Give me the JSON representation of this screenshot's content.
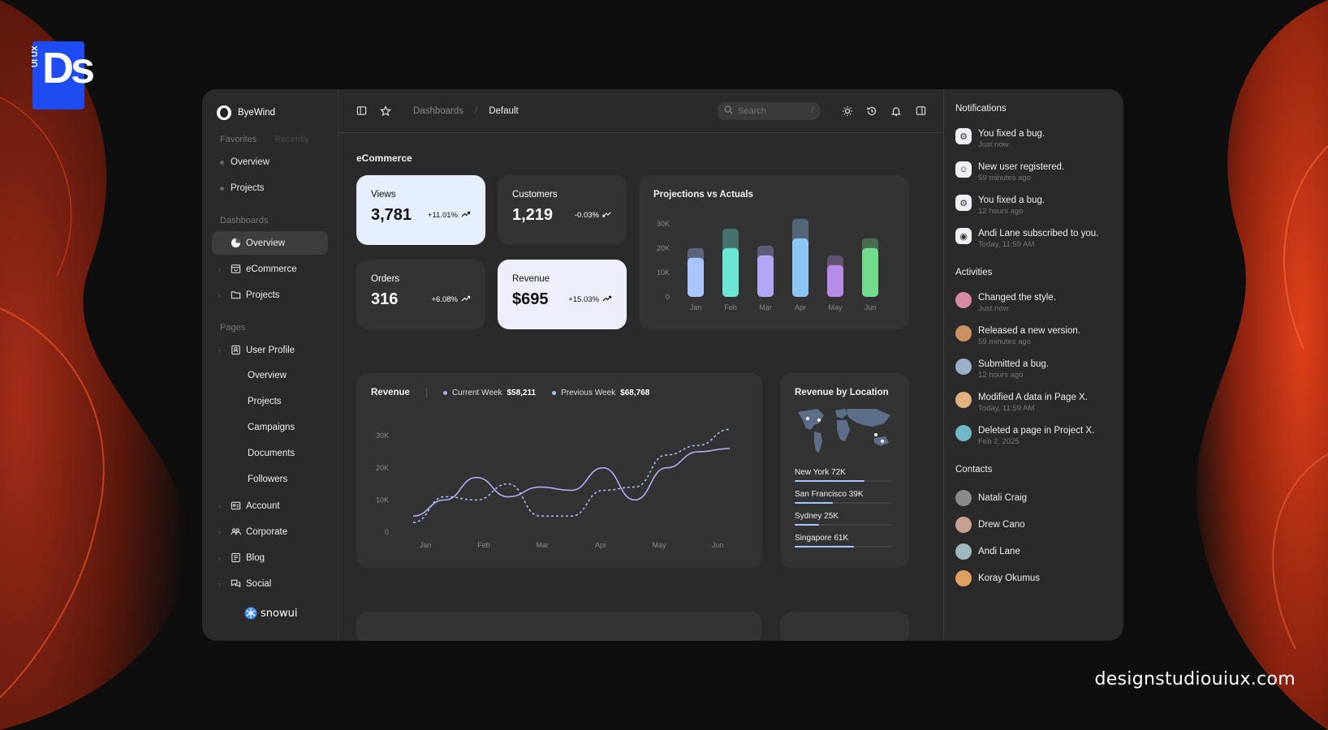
{
  "brand": {
    "name": "ByeWind",
    "logo_text": "Ds",
    "logo_side": "UI UX"
  },
  "watermark": "designstudiouiux.com",
  "sidebar": {
    "tabs": [
      "Favorites",
      "Recently"
    ],
    "favorites": [
      "Overview",
      "Projects"
    ],
    "dashboards_title": "Dashboards",
    "dashboards": [
      {
        "label": "Overview",
        "icon": "pie-chart-icon",
        "active": true
      },
      {
        "label": "eCommerce",
        "icon": "shopping-bag-icon"
      },
      {
        "label": "Projects",
        "icon": "folder-icon"
      }
    ],
    "pages_title": "Pages",
    "user_profile": {
      "label": "User Profile",
      "icon": "id-badge-icon"
    },
    "user_profile_sub": [
      "Overview",
      "Projects",
      "Campaigns",
      "Documents",
      "Followers"
    ],
    "pages": [
      {
        "label": "Account",
        "icon": "id-card-icon"
      },
      {
        "label": "Corporate",
        "icon": "users-icon"
      },
      {
        "label": "Blog",
        "icon": "notebook-icon"
      },
      {
        "label": "Social",
        "icon": "chat-bubbles-icon"
      }
    ],
    "footer_logo": "snowui"
  },
  "topbar": {
    "breadcrumb": [
      "Dashboards",
      "Default"
    ],
    "separator": "/",
    "search_placeholder": "Search",
    "search_shortcut": "/"
  },
  "main": {
    "heading": "eCommerce",
    "stats": [
      {
        "label": "Views",
        "value": "3,781",
        "change": "+11.01%",
        "trend": "up"
      },
      {
        "label": "Customers",
        "value": "1,219",
        "change": "-0.03%",
        "trend": "down"
      },
      {
        "label": "Orders",
        "value": "316",
        "change": "+6.08%",
        "trend": "up"
      },
      {
        "label": "Revenue",
        "value": "$695",
        "change": "+15.03%",
        "trend": "up"
      }
    ],
    "projections_title": "Projections vs Actuals",
    "revenue_title": "Revenue",
    "revenue_legend": [
      {
        "label": "Current Week",
        "value": "$58,211",
        "color": "#a8a8ff"
      },
      {
        "label": "Previous Week",
        "value": "$68,768",
        "color": "#a8c5ff"
      }
    ],
    "location_title": "Revenue by Location",
    "locations": [
      {
        "label": "New York",
        "value": "72K",
        "fraction": 0.72
      },
      {
        "label": "San Francisco",
        "value": "39K",
        "fraction": 0.39
      },
      {
        "label": "Sydney",
        "value": "25K",
        "fraction": 0.25
      },
      {
        "label": "Singapore",
        "value": "61K",
        "fraction": 0.61
      }
    ]
  },
  "chart_data": [
    {
      "type": "bar",
      "title": "Projections vs Actuals",
      "categories": [
        "Jan",
        "Feb",
        "Mar",
        "Apr",
        "May",
        "Jun"
      ],
      "yticks": [
        "0",
        "10K",
        "20K",
        "30K"
      ],
      "ylim": [
        0,
        30000
      ],
      "series": [
        {
          "values": [
            16000,
            20000,
            17000,
            24000,
            13000,
            20000
          ]
        },
        {
          "values": [
            20000,
            28000,
            21000,
            32000,
            17000,
            24000
          ]
        }
      ],
      "colors": [
        "#a8c5ff",
        "#6be6d3",
        "#b0a8f5",
        "#8ac5f5",
        "#b78ce8",
        "#71dd8c"
      ],
      "grid": false
    },
    {
      "type": "line",
      "title": "Revenue",
      "categories": [
        "Jan",
        "Feb",
        "Mar",
        "Apr",
        "May",
        "Jun"
      ],
      "yticks": [
        "0",
        "10K",
        "20K",
        "30K"
      ],
      "ylim": [
        0,
        30000
      ],
      "series": [
        {
          "name": "Current Week",
          "values": [
            5000,
            10000,
            17000,
            11000,
            14000,
            13000,
            20000,
            10000,
            20000,
            25000,
            26000
          ],
          "style": "solid"
        },
        {
          "name": "Previous Week",
          "values": [
            3000,
            11000,
            10000,
            15000,
            5000,
            5000,
            13000,
            14000,
            24000,
            27000,
            32000
          ],
          "style": "dashed"
        }
      ]
    }
  ],
  "notifications": {
    "title": "Notifications",
    "items": [
      {
        "text": "You fixed a bug.",
        "time": "Just now",
        "icon": "bug-icon"
      },
      {
        "text": "New user registered.",
        "time": "59 minutes ago",
        "icon": "user-icon"
      },
      {
        "text": "You fixed a bug.",
        "time": "12 hours ago",
        "icon": "bug-icon"
      },
      {
        "text": "Andi Lane subscribed to you.",
        "time": "Today, 11:59 AM",
        "icon": "broadcast-icon"
      }
    ]
  },
  "activities": {
    "title": "Activities",
    "items": [
      {
        "text": "Changed the style.",
        "time": "Just now",
        "color": "#d88aa0"
      },
      {
        "text": "Released a new version.",
        "time": "59 minutes ago",
        "color": "#c99060"
      },
      {
        "text": "Submitted a bug.",
        "time": "12 hours ago",
        "color": "#9ab0c8"
      },
      {
        "text": "Modified A data in Page X.",
        "time": "Today, 11:59 AM",
        "color": "#e0b080"
      },
      {
        "text": "Deleted a page in Project X.",
        "time": "Feb 2, 2025",
        "color": "#70b8c8"
      }
    ]
  },
  "contacts": {
    "title": "Contacts",
    "items": [
      {
        "name": "Natali Craig",
        "color": "#8a8a8a"
      },
      {
        "name": "Drew Cano",
        "color": "#c8a090"
      },
      {
        "name": "Andi Lane",
        "color": "#a0b8c0"
      },
      {
        "name": "Koray Okumus",
        "color": "#e0a060"
      }
    ]
  }
}
